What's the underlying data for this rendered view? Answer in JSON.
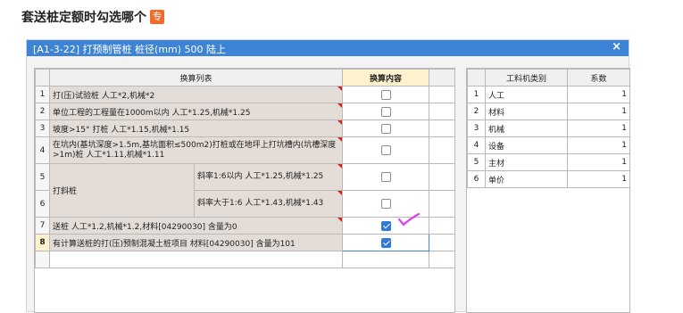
{
  "page": {
    "heading": "套送桩定额时勾选哪个",
    "badge": "专"
  },
  "dialog": {
    "title": "[A1-3-22] 打预制管桩 桩径(mm) 500 陆上",
    "close_label": "×"
  },
  "conversion_table": {
    "headers": {
      "list": "换算列表",
      "content": "换算内容"
    },
    "rows": [
      {
        "no": "1",
        "text": "打(压)试验桩 人工*2,机械*2",
        "checked": false
      },
      {
        "no": "2",
        "text": "单位工程的工程量在1000m以内 人工*1.25,机械*1.25",
        "checked": false
      },
      {
        "no": "3",
        "text": "坡度>15° 打桩 人工*1.15,机械*1.15",
        "checked": false
      },
      {
        "no": "4",
        "text": "在坑内(基坑深度>1.5m,基坑面积≤500m2)打桩或在地坪上打坑槽内(坑槽深度>1m)桩 人工*1.11,机械*1.11",
        "checked": false
      },
      {
        "no": "5",
        "group": "打斜桩",
        "text": "斜率1:6以内 人工*1.25,机械*1.25",
        "checked": false
      },
      {
        "no": "6",
        "text": "斜率大于1:6 人工*1.43,机械*1.43",
        "checked": false
      },
      {
        "no": "7",
        "text": "送桩 人工*1.2,机械*1.2,材料[04290030] 含量为0",
        "checked": true
      },
      {
        "no": "8",
        "text": "有计算送桩的打(压)预制混凝土桩项目 材料[04290030] 含量为101",
        "checked": true
      }
    ]
  },
  "coef_table": {
    "headers": {
      "category": "工料机类别",
      "factor": "系数"
    },
    "rows": [
      {
        "no": "1",
        "category": "人工",
        "factor": "1"
      },
      {
        "no": "2",
        "category": "材料",
        "factor": "1"
      },
      {
        "no": "3",
        "category": "机械",
        "factor": "1"
      },
      {
        "no": "4",
        "category": "设备",
        "factor": "1"
      },
      {
        "no": "5",
        "category": "主材",
        "factor": "1"
      },
      {
        "no": "6",
        "category": "单价",
        "factor": "1"
      }
    ]
  },
  "annotation": {
    "color": "#e040e8"
  }
}
